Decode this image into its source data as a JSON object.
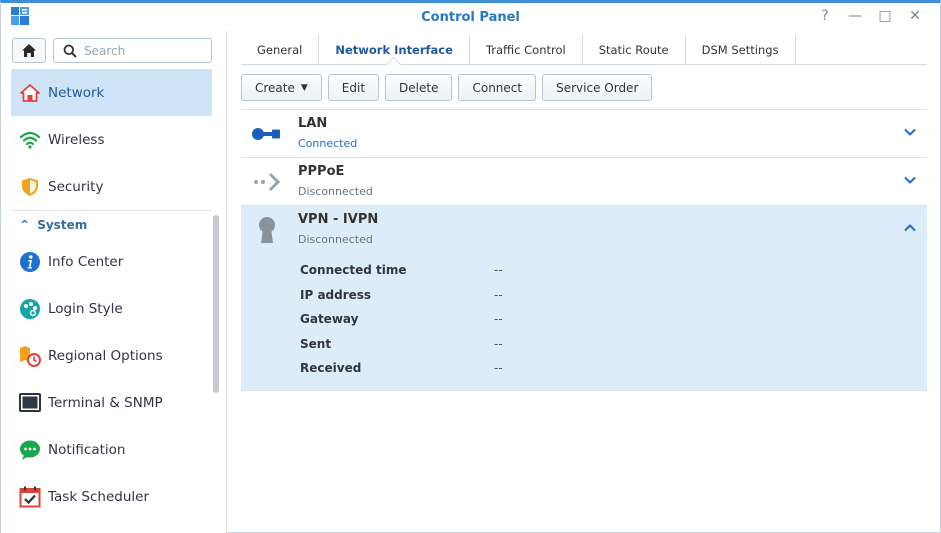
{
  "window": {
    "title": "Control Panel"
  },
  "title_buttons": {
    "help": "?",
    "minimize": "—",
    "maximize": "□",
    "close": "✕"
  },
  "search": {
    "placeholder": "Search"
  },
  "sidebar": {
    "items": [
      {
        "label": "Network",
        "icon": "home-network-icon"
      },
      {
        "label": "Wireless",
        "icon": "wifi-icon"
      },
      {
        "label": "Security",
        "icon": "shield-icon"
      }
    ],
    "group": {
      "label": "System",
      "chevron": "^"
    },
    "system_items": [
      {
        "label": "Info Center",
        "icon": "info-icon"
      },
      {
        "label": "Login Style",
        "icon": "palette-icon"
      },
      {
        "label": "Regional Options",
        "icon": "regional-clock-icon"
      },
      {
        "label": "Terminal & SNMP",
        "icon": "terminal-icon"
      },
      {
        "label": "Notification",
        "icon": "chat-bubble-icon"
      },
      {
        "label": "Task Scheduler",
        "icon": "calendar-check-icon"
      }
    ]
  },
  "tabs": [
    {
      "label": "General"
    },
    {
      "label": "Network Interface"
    },
    {
      "label": "Traffic Control"
    },
    {
      "label": "Static Route"
    },
    {
      "label": "DSM Settings"
    }
  ],
  "toolbar": {
    "create": "Create",
    "edit": "Edit",
    "delete": "Delete",
    "connect": "Connect",
    "service_order": "Service Order"
  },
  "interfaces": [
    {
      "name": "LAN",
      "status": "Connected"
    },
    {
      "name": "PPPoE",
      "status": "Disconnected"
    },
    {
      "name": "VPN - IVPN",
      "status": "Disconnected"
    }
  ],
  "vpn_details": [
    {
      "label": "Connected time",
      "value": "--"
    },
    {
      "label": "IP address",
      "value": "--"
    },
    {
      "label": "Gateway",
      "value": "--"
    },
    {
      "label": "Sent",
      "value": "--"
    },
    {
      "label": "Received",
      "value": "--"
    }
  ],
  "colors": {
    "accent": "#2878c8",
    "selected_bg": "#cfe4f7",
    "expanded_bg": "#dcecf8",
    "connected": "#1e6ec8"
  }
}
